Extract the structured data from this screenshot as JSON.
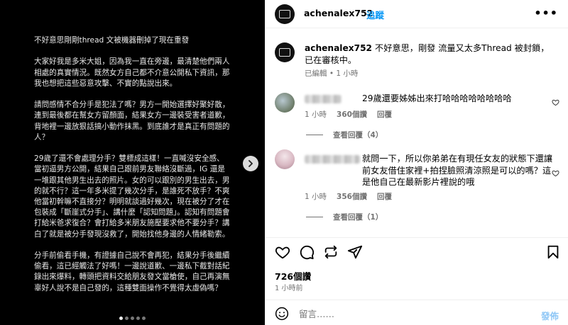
{
  "post_image": {
    "paragraphs": [
      "不好意思剛剛thread 文被機器刪掉了現在重發",
      "大家好我是多米大姐，因為我一直在旁邊，最清楚他們兩人相處的真實情況。既然女方自己都不介意公開私下資訊，那我也想把這些惡意攻擊、不實的點說出來。",
      "請問感情不合分手是犯法了嗎？男方一開始選擇好聚好散，連到最後都在幫女方留顏面，結果女方一邊裝受害者道歉，背地裡一邊放狠話搞小動作抹黑。到底誰才是真正有問題的人？",
      "29歲了還不會處理分手？雙標成這樣！一直喊沒安全感、當初逼男方公開，結果自己跟前男友聯絡沒斷過，IG 還是一堆跟其他男生出去的照片。女的可以跟別的男生出去，男的就不行？這一年多米提了幾次分手，是誰死不放手？不爽他當初幹嘛不直接分？明明就談過好幾次，現在被分了才在包裝成「斷崖式分手」、講什麼「認知問題」。認知有問題會打給米爸求復合？會打給多米朋友施壓要求他不要分手？講白了就是被分手發現沒救了，開始找他身邊的人情緒勒索。",
      "分手前偷看手機，有證據自己說不會再犯，結果分手後繼續偷看，這已經觸法了好嗎！一邊說道歉、一邊私下截對話紀錄出來爆料，轉頭把資料交給朋友發文當槍使，自己再演無辜好人說不是自己發的，這種雙面操作不覺得太虛偽嗎？"
    ],
    "dots": [
      true,
      false,
      false,
      false,
      false
    ]
  },
  "header": {
    "username": "achenalex752",
    "separator": "•",
    "follow_label": "追蹤",
    "more_label": "•••"
  },
  "caption": {
    "username": "achenalex752",
    "text": "不好意思，剛發 流量又太多Thread 被封鎖，已在審核中。",
    "edited_label": "已編輯",
    "separator": "•",
    "time": "1 小時"
  },
  "comments": [
    {
      "text": "29歲還要姊姊出來打哈哈哈哈哈哈哈哈",
      "time": "1 小時",
      "likes": "360個讚",
      "reply_label": "回覆",
      "view_replies": "查看回覆（4）"
    },
    {
      "text": "就問一下，所以你弟弟在有現任女友的狀態下還讓前女友借住家裡+拍捏臉照清涼照是可以的嗎？這是他自己在最新影片裡說的哦",
      "time": "1 小時",
      "likes": "356個讚",
      "reply_label": "回覆",
      "view_replies": "查看回覆（1）"
    }
  ],
  "actions": {
    "likes": "726個讚",
    "time": "1 小時前"
  },
  "comment_bar": {
    "placeholder": "留言……",
    "post_label": "發佈"
  },
  "icons": [
    "chevron-right-icon",
    "more-icon",
    "heart-icon",
    "comment-icon",
    "repost-icon",
    "share-icon",
    "bookmark-icon",
    "emoji-icon"
  ]
}
